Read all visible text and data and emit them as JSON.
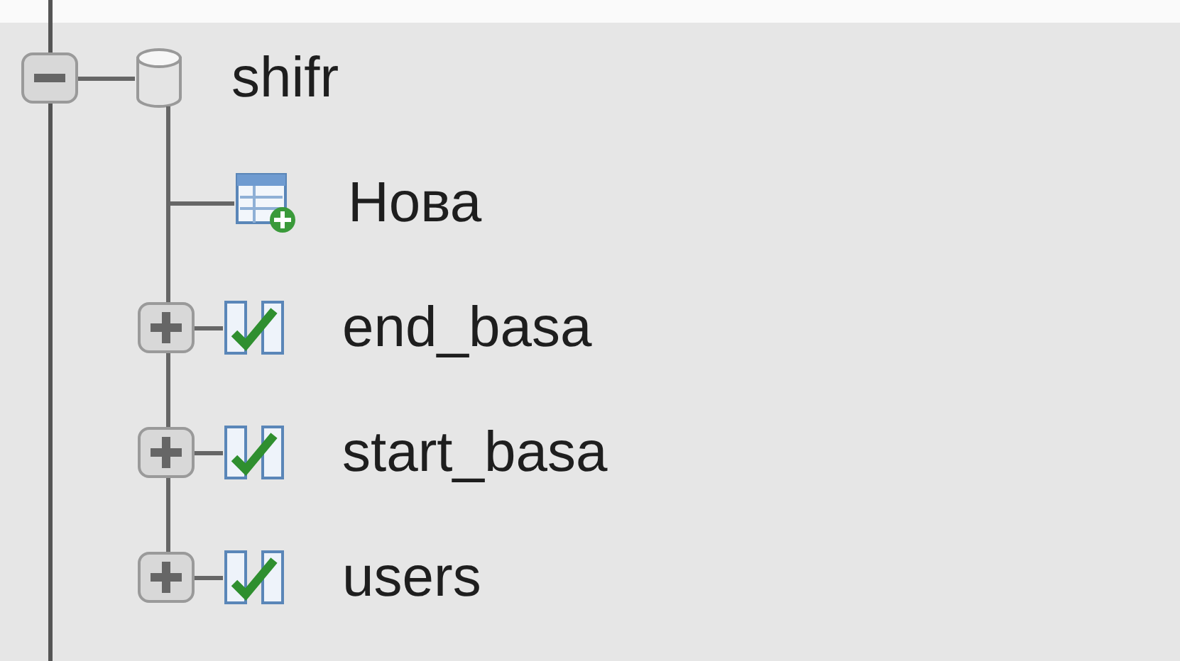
{
  "tree": [
    {
      "kind": "database",
      "label": "shifr",
      "expanded": true,
      "children": [
        {
          "kind": "new",
          "label": "Нова"
        },
        {
          "kind": "table",
          "label": "end_basa",
          "expanded": false
        },
        {
          "kind": "table",
          "label": "start_basa",
          "expanded": false
        },
        {
          "kind": "table",
          "label": "users",
          "expanded": false
        }
      ]
    }
  ]
}
